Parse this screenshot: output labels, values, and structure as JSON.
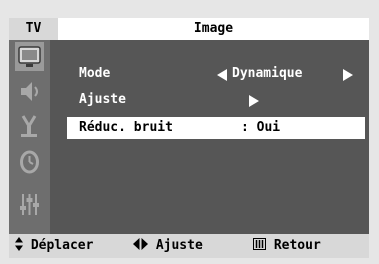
{
  "header": {
    "tab": "TV",
    "title": "Image"
  },
  "menu": {
    "mode": {
      "label": "Mode",
      "value": "Dynamique"
    },
    "ajuste": {
      "label": "Ajuste"
    },
    "reduc": {
      "label": "Réduc. bruit",
      "value": ": Oui"
    }
  },
  "sidebar_icons": [
    "picture-icon",
    "sound-icon",
    "channel-icon",
    "timer-icon",
    "setup-icon"
  ],
  "footer": {
    "move": "Déplacer",
    "adjust": "Ajuste",
    "return": "Retour"
  },
  "colors": {
    "panel": "#565656",
    "icon_column": "#6e6e6e",
    "bars": "#d8d8d8",
    "selection": "#ffffff"
  }
}
